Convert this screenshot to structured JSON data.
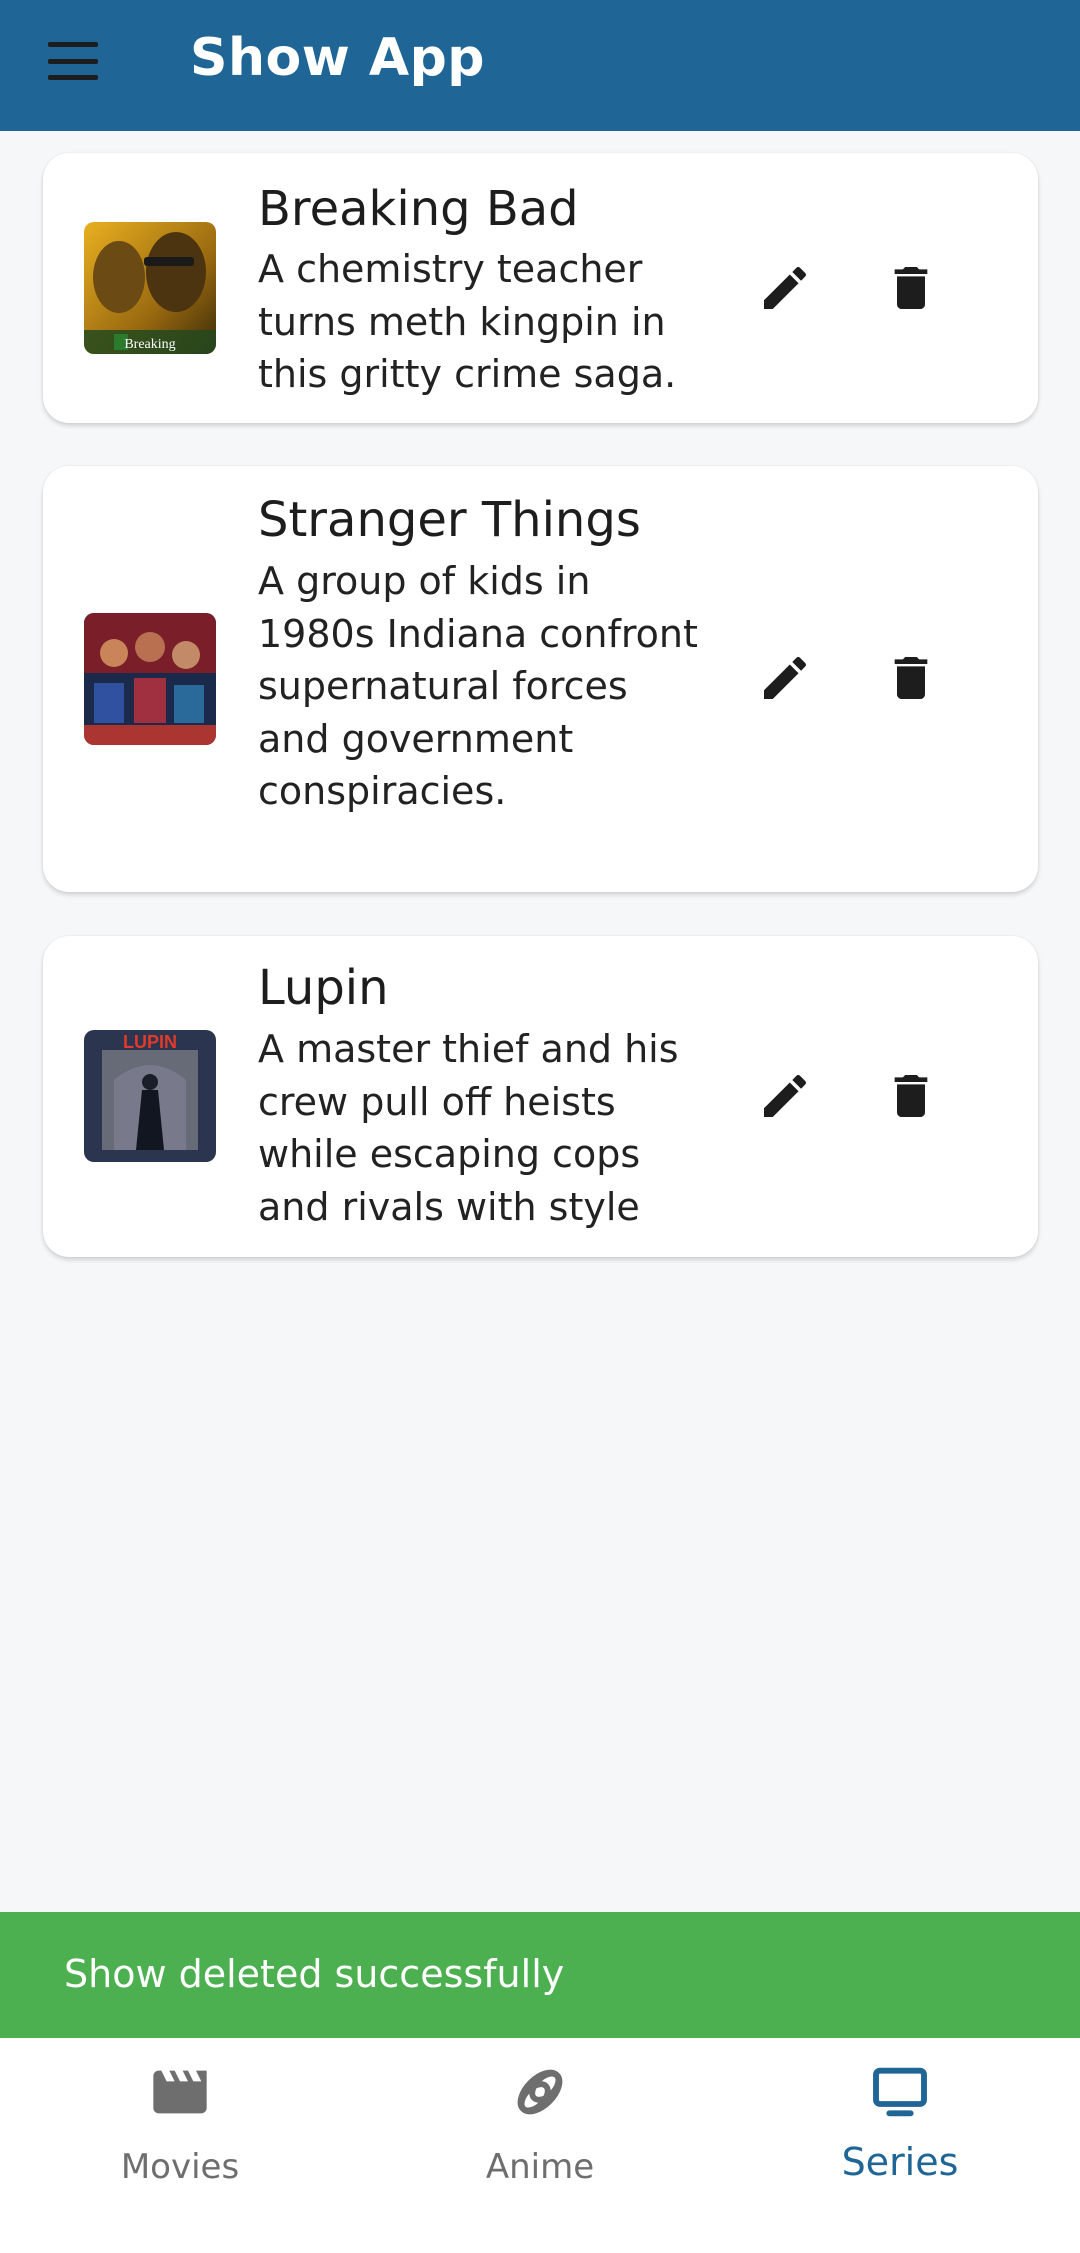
{
  "app": {
    "title": "Show App"
  },
  "colors": {
    "app_bar": "#1f6696",
    "snackbar": "#4caf50",
    "active_nav": "#1f6696",
    "inactive_nav": "#6e6e6e"
  },
  "shows": [
    {
      "title": "Breaking Bad",
      "description": "A chemistry teacher turns meth kingpin in this gritty crime saga.",
      "poster_text": "Breaking",
      "edit_icon": "pencil-icon",
      "delete_icon": "trash-icon"
    },
    {
      "title": "Stranger Things",
      "description": "A group of kids in 1980s Indiana confront supernatural forces and government conspiracies.",
      "edit_icon": "pencil-icon",
      "delete_icon": "trash-icon"
    },
    {
      "title": "Lupin",
      "description": "A master thief and his crew pull off heists while escaping cops and rivals with style",
      "poster_text": "LUPIN",
      "edit_icon": "pencil-icon",
      "delete_icon": "trash-icon"
    }
  ],
  "snackbar": {
    "message": "Show deleted successfully"
  },
  "bottom_nav": {
    "items": [
      {
        "label": "Movies",
        "icon": "clapperboard-icon",
        "active": false
      },
      {
        "label": "Anime",
        "icon": "rings-icon",
        "active": false
      },
      {
        "label": "Series",
        "icon": "tv-icon",
        "active": true
      }
    ]
  }
}
